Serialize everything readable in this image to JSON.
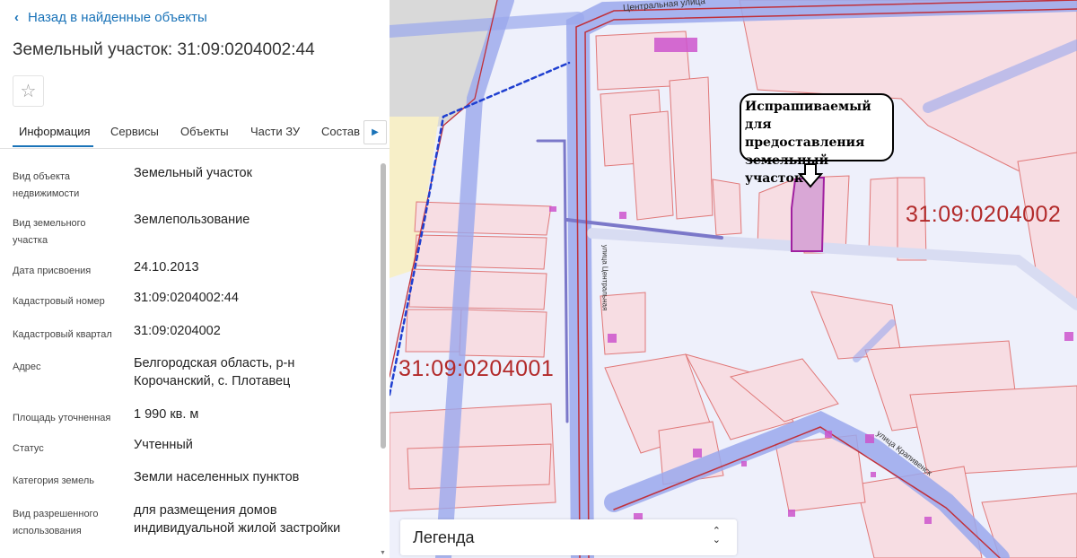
{
  "panel": {
    "back_label": "Назад в найденные объекты",
    "title": "Земельный участок: 31:09:0204002:44",
    "tabs": [
      "Информация",
      "Сервисы",
      "Объекты",
      "Части ЗУ",
      "Состав"
    ],
    "active_tab": "Информация",
    "fields": [
      {
        "label": "Вид объекта недвижимости",
        "value": "Земельный участок"
      },
      {
        "label": "Вид земельного участка",
        "value": "Землепользование"
      },
      {
        "label": "Дата присвоения",
        "value": "24.10.2013"
      },
      {
        "label": "Кадастровый номер",
        "value": "31:09:0204002:44"
      },
      {
        "label": "Кадастровый квартал",
        "value": "31:09:0204002"
      },
      {
        "label": "Адрес",
        "value": "Белгородская область, р-н Корочанский, с. Плотавец"
      },
      {
        "label": "Площадь уточненная",
        "value": "1 990 кв. м"
      },
      {
        "label": "Статус",
        "value": "Учтенный"
      },
      {
        "label": "Категория земель",
        "value": "Земли населенных пунктов"
      },
      {
        "label": "Вид разрешенного использования",
        "value": "для размещения домов индивидуальной жилой застройки"
      }
    ]
  },
  "map": {
    "quarter_labels": [
      "31:09:0204002",
      "31:09:0204001"
    ],
    "streets": [
      "Центральная улица",
      "улица Крапивенск",
      "улица Центральная"
    ],
    "callout_text": "Испрашиваемый для предоставления земельный участок",
    "legend_label": "Легенда",
    "colors": {
      "parcel_fill": "#f7dde3",
      "parcel_stroke": "#e07878",
      "road": "#9aa8ec",
      "road_line": "#c0303a",
      "highlight": "#a020a0"
    }
  },
  "icons": {
    "back": "chevron-left-icon",
    "favorite": "star-icon",
    "tabs_next": "triangle-right-icon",
    "legend": "up-down-chevron-icon"
  }
}
